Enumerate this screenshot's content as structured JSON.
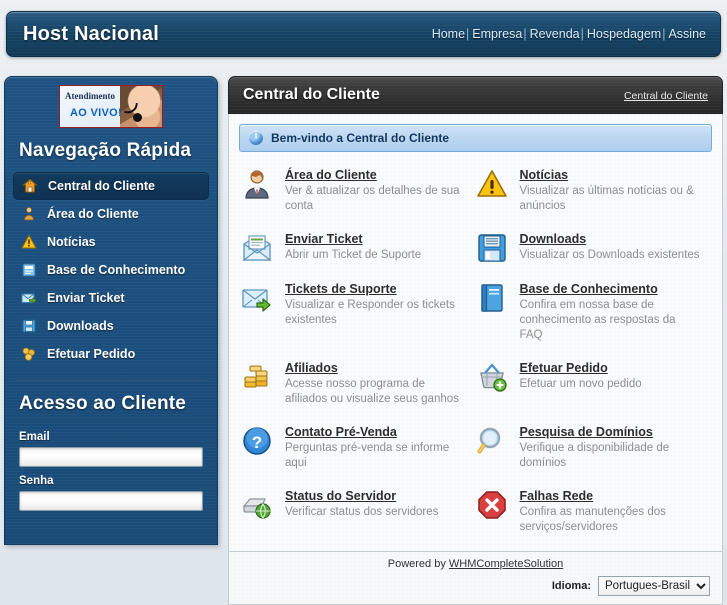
{
  "header": {
    "brand": "Host Nacional",
    "nav": [
      {
        "label": "Home"
      },
      {
        "label": "Empresa"
      },
      {
        "label": "Revenda"
      },
      {
        "label": "Hospedagem"
      },
      {
        "label": "Assine"
      }
    ],
    "separator": "|"
  },
  "sidebar": {
    "banner": {
      "line1": "Atendimento",
      "line2": "AO VIVO!"
    },
    "nav_title": "Navegação Rápida",
    "items": [
      {
        "label": "Central do Cliente",
        "icon": "home-icon",
        "active": true
      },
      {
        "label": "Área do Cliente",
        "icon": "user-icon",
        "active": false
      },
      {
        "label": "Notícias",
        "icon": "warning-icon",
        "active": false
      },
      {
        "label": "Base de Conhecimento",
        "icon": "book-icon",
        "active": false
      },
      {
        "label": "Enviar Ticket",
        "icon": "mail-send-icon",
        "active": false
      },
      {
        "label": "Downloads",
        "icon": "floppy-icon",
        "active": false
      },
      {
        "label": "Efetuar Pedido",
        "icon": "cart-icon",
        "active": false
      }
    ],
    "login_title": "Acesso ao Cliente",
    "email_label": "Email",
    "email_value": "",
    "email_placeholder": "",
    "password_label": "Senha",
    "password_value": "",
    "password_placeholder": ""
  },
  "main": {
    "page_title": "Central do Cliente",
    "breadcrumb": "Central do Cliente",
    "welcome": "Bem-vindo a Central do Cliente",
    "welcome_icon": "info-icon",
    "items": [
      {
        "title": "Área do Cliente",
        "desc": "Ver & atualizar os detalhes de sua conta",
        "icon": "user-profile-icon"
      },
      {
        "title": "Notícias",
        "desc": "Visualizar as últimas notícias ou & anúncios",
        "icon": "warning-triangle-icon"
      },
      {
        "title": "Enviar Ticket",
        "desc": "Abrir um Ticket de Suporte",
        "icon": "open-envelope-icon"
      },
      {
        "title": "Downloads",
        "desc": "Visualizar os Downloads existentes",
        "icon": "floppy-disk-icon"
      },
      {
        "title": "Tickets de Suporte",
        "desc": "Visualizar e Responder os tickets existentes",
        "icon": "envelope-arrow-icon"
      },
      {
        "title": "Base de Conhecimento",
        "desc": "Confira em nossa base de conhecimento as respostas da FAQ",
        "icon": "blue-book-icon"
      },
      {
        "title": "Afiliados",
        "desc": "Acesse nosso programa de afiliados ou visualize seus ganhos",
        "icon": "coins-icon"
      },
      {
        "title": "Efetuar Pedido",
        "desc": "Efetuar um novo pedido",
        "icon": "shopping-basket-add-icon"
      },
      {
        "title": "Contato Pré-Venda",
        "desc": "Perguntas pré-venda se informe aqui",
        "icon": "question-mark-icon"
      },
      {
        "title": "Pesquisa de Domínios",
        "desc": "Verifique a disponibilidade de domínios",
        "icon": "magnifier-icon"
      },
      {
        "title": "Status do Servidor",
        "desc": "Verificar status dos servidores",
        "icon": "server-globe-icon"
      },
      {
        "title": "Falhas Rede",
        "desc": "Confira as manutenções dos serviços/servidores",
        "icon": "error-octagon-icon"
      }
    ]
  },
  "footer": {
    "powered_prefix": "Powered by ",
    "powered_link": "WHMCompleteSolution",
    "lang_label": "Idioma:",
    "lang_selected": "Portugues-Brasil",
    "lang_options": [
      "Portugues-Brasil"
    ]
  },
  "colors": {
    "brand_blue": "#1b4f7e",
    "header_navy": "#14405f",
    "page_bg": "#dfe6ec",
    "panel_bg": "#fafbfc",
    "title_bar": "#2c2c2c",
    "welcome_bg": "#bcd7f1",
    "link_text": "#2d2d2d",
    "desc_text": "#8d8d8d"
  }
}
